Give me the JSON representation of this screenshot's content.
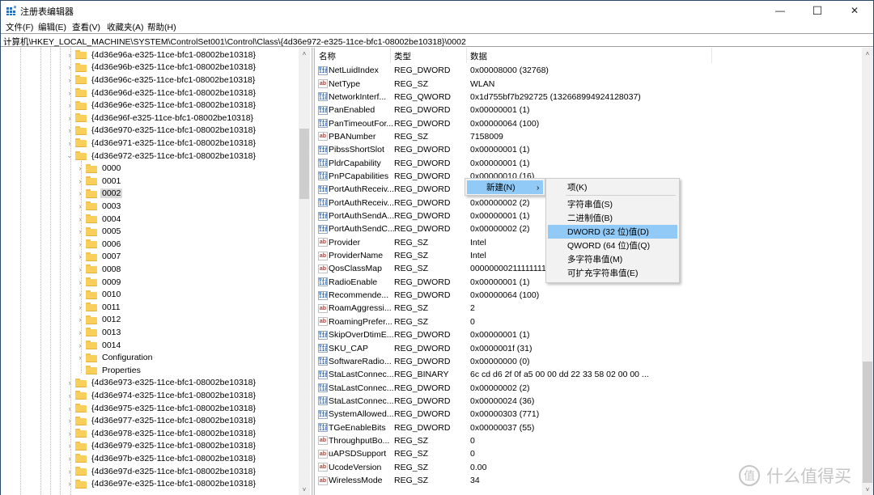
{
  "window": {
    "title": "注册表编辑器",
    "controls": {
      "minimize": "—",
      "maximize": "☐",
      "close": "✕"
    }
  },
  "menu": [
    "文件(F)",
    "编辑(E)",
    "查看(V)",
    "收藏夹(A)",
    "帮助(H)"
  ],
  "address": "计算机\\HKEY_LOCAL_MACHINE\\SYSTEM\\ControlSet001\\Control\\Class\\{4d36e972-e325-11ce-bfc1-08002be10318}\\0002",
  "tree": {
    "items": [
      {
        "label": "{4d36e96a-e325-11ce-bfc1-08002be10318}",
        "level": 0,
        "expander": ">"
      },
      {
        "label": "{4d36e96b-e325-11ce-bfc1-08002be10318}",
        "level": 0,
        "expander": ">"
      },
      {
        "label": "{4d36e96c-e325-11ce-bfc1-08002be10318}",
        "level": 0,
        "expander": ">"
      },
      {
        "label": "{4d36e96d-e325-11ce-bfc1-08002be10318}",
        "level": 0,
        "expander": ">"
      },
      {
        "label": "{4d36e96e-e325-11ce-bfc1-08002be10318}",
        "level": 0,
        "expander": ">"
      },
      {
        "label": "{4d36e96f-e325-11ce-bfc1-08002be10318}",
        "level": 0,
        "expander": ">"
      },
      {
        "label": "{4d36e970-e325-11ce-bfc1-08002be10318}",
        "level": 0,
        "expander": ">"
      },
      {
        "label": "{4d36e971-e325-11ce-bfc1-08002be10318}",
        "level": 0,
        "expander": ">"
      },
      {
        "label": "{4d36e972-e325-11ce-bfc1-08002be10318}",
        "level": 0,
        "expander": "v"
      },
      {
        "label": "0000",
        "level": 1,
        "expander": ">"
      },
      {
        "label": "0001",
        "level": 1,
        "expander": ">"
      },
      {
        "label": "0002",
        "level": 1,
        "expander": ">",
        "selected": true
      },
      {
        "label": "0003",
        "level": 1,
        "expander": ">"
      },
      {
        "label": "0004",
        "level": 1,
        "expander": ">"
      },
      {
        "label": "0005",
        "level": 1,
        "expander": ">"
      },
      {
        "label": "0006",
        "level": 1,
        "expander": ">"
      },
      {
        "label": "0007",
        "level": 1,
        "expander": ">"
      },
      {
        "label": "0008",
        "level": 1,
        "expander": ">"
      },
      {
        "label": "0009",
        "level": 1,
        "expander": ">"
      },
      {
        "label": "0010",
        "level": 1,
        "expander": ">"
      },
      {
        "label": "0011",
        "level": 1,
        "expander": ">"
      },
      {
        "label": "0012",
        "level": 1,
        "expander": ">"
      },
      {
        "label": "0013",
        "level": 1,
        "expander": ">"
      },
      {
        "label": "0014",
        "level": 1,
        "expander": ">"
      },
      {
        "label": "Configuration",
        "level": 1,
        "expander": ">"
      },
      {
        "label": "Properties",
        "level": 1,
        "expander": ""
      },
      {
        "label": "{4d36e973-e325-11ce-bfc1-08002be10318}",
        "level": 0,
        "expander": ">"
      },
      {
        "label": "{4d36e974-e325-11ce-bfc1-08002be10318}",
        "level": 0,
        "expander": ">"
      },
      {
        "label": "{4d36e975-e325-11ce-bfc1-08002be10318}",
        "level": 0,
        "expander": ">"
      },
      {
        "label": "{4d36e977-e325-11ce-bfc1-08002be10318}",
        "level": 0,
        "expander": ">"
      },
      {
        "label": "{4d36e978-e325-11ce-bfc1-08002be10318}",
        "level": 0,
        "expander": ">"
      },
      {
        "label": "{4d36e979-e325-11ce-bfc1-08002be10318}",
        "level": 0,
        "expander": ">"
      },
      {
        "label": "{4d36e97b-e325-11ce-bfc1-08002be10318}",
        "level": 0,
        "expander": ">"
      },
      {
        "label": "{4d36e97d-e325-11ce-bfc1-08002be10318}",
        "level": 0,
        "expander": ">"
      },
      {
        "label": "{4d36e97e-e325-11ce-bfc1-08002be10318}",
        "level": 0,
        "expander": ">"
      }
    ]
  },
  "list": {
    "columns": [
      "名称",
      "类型",
      "数据"
    ],
    "rows": [
      {
        "icon": "bin",
        "name": "NetLuidIndex",
        "type": "REG_DWORD",
        "data": "0x00008000 (32768)"
      },
      {
        "icon": "sz",
        "name": "NetType",
        "type": "REG_SZ",
        "data": "WLAN"
      },
      {
        "icon": "bin",
        "name": "NetworkInterf...",
        "type": "REG_QWORD",
        "data": "0x1d755bf7b292725 (132668994924128037)"
      },
      {
        "icon": "bin",
        "name": "PanEnabled",
        "type": "REG_DWORD",
        "data": "0x00000001 (1)"
      },
      {
        "icon": "bin",
        "name": "PanTimeoutFor...",
        "type": "REG_DWORD",
        "data": "0x00000064 (100)"
      },
      {
        "icon": "sz",
        "name": "PBANumber",
        "type": "REG_SZ",
        "data": "7158009"
      },
      {
        "icon": "bin",
        "name": "PibssShortSlot",
        "type": "REG_DWORD",
        "data": "0x00000001 (1)"
      },
      {
        "icon": "bin",
        "name": "PldrCapability",
        "type": "REG_DWORD",
        "data": "0x00000001 (1)"
      },
      {
        "icon": "bin",
        "name": "PnPCapabilities",
        "type": "REG_DWORD",
        "data": "0x00000010 (16)"
      },
      {
        "icon": "bin",
        "name": "PortAuthReceiv...",
        "type": "REG_DWORD",
        "data": ""
      },
      {
        "icon": "bin",
        "name": "PortAuthReceiv...",
        "type": "REG_DWORD",
        "data": "0x00000002 (2)"
      },
      {
        "icon": "bin",
        "name": "PortAuthSendA...",
        "type": "REG_DWORD",
        "data": "0x00000001 (1)"
      },
      {
        "icon": "bin",
        "name": "PortAuthSendC...",
        "type": "REG_DWORD",
        "data": "0x00000002 (2)"
      },
      {
        "icon": "sz",
        "name": "Provider",
        "type": "REG_SZ",
        "data": "Intel"
      },
      {
        "icon": "sz",
        "name": "ProviderName",
        "type": "REG_SZ",
        "data": "Intel"
      },
      {
        "icon": "sz",
        "name": "QosClassMap",
        "type": "REG_SZ",
        "data": "0000000021111111122"
      },
      {
        "icon": "bin",
        "name": "RadioEnable",
        "type": "REG_DWORD",
        "data": "0x00000001 (1)"
      },
      {
        "icon": "bin",
        "name": "Recommende...",
        "type": "REG_DWORD",
        "data": "0x00000064 (100)"
      },
      {
        "icon": "sz",
        "name": "RoamAggressi...",
        "type": "REG_SZ",
        "data": "2"
      },
      {
        "icon": "sz",
        "name": "RoamingPrefer...",
        "type": "REG_SZ",
        "data": "0"
      },
      {
        "icon": "bin",
        "name": "SkipOverDtimE...",
        "type": "REG_DWORD",
        "data": "0x00000001 (1)"
      },
      {
        "icon": "bin",
        "name": "SKU_CAP",
        "type": "REG_DWORD",
        "data": "0x0000001f (31)"
      },
      {
        "icon": "bin",
        "name": "SoftwareRadio...",
        "type": "REG_DWORD",
        "data": "0x00000000 (0)"
      },
      {
        "icon": "bin",
        "name": "StaLastConnec...",
        "type": "REG_BINARY",
        "data": "6c cd d6 2f 0f a5 00 00 dd 22 33 58 02 00 00 ..."
      },
      {
        "icon": "bin",
        "name": "StaLastConnec...",
        "type": "REG_DWORD",
        "data": "0x00000002 (2)"
      },
      {
        "icon": "bin",
        "name": "StaLastConnec...",
        "type": "REG_DWORD",
        "data": "0x00000024 (36)"
      },
      {
        "icon": "bin",
        "name": "SystemAllowed...",
        "type": "REG_DWORD",
        "data": "0x00000303 (771)"
      },
      {
        "icon": "bin",
        "name": "TGeEnableBits",
        "type": "REG_DWORD",
        "data": "0x00000037 (55)"
      },
      {
        "icon": "sz",
        "name": "ThroughputBo...",
        "type": "REG_SZ",
        "data": "0"
      },
      {
        "icon": "sz",
        "name": "uAPSDSupport",
        "type": "REG_SZ",
        "data": "0"
      },
      {
        "icon": "sz",
        "name": "UcodeVersion",
        "type": "REG_SZ",
        "data": "0.00"
      },
      {
        "icon": "sz",
        "name": "WirelessMode",
        "type": "REG_SZ",
        "data": "34"
      }
    ]
  },
  "context_menu": {
    "new_label": "新建(N)",
    "submenu_arrow": "›",
    "submenu": [
      {
        "label": "项(K)"
      },
      {
        "separator": true
      },
      {
        "label": "字符串值(S)"
      },
      {
        "label": "二进制值(B)"
      },
      {
        "label": "DWORD (32 位)值(D)",
        "highlighted": true
      },
      {
        "label": "QWORD (64 位)值(Q)"
      },
      {
        "label": "多字符串值(M)"
      },
      {
        "label": "可扩充字符串值(E)"
      }
    ]
  },
  "icons": {
    "bin_glyph": "011\n110",
    "sz_glyph": "ab"
  },
  "scroll_glyphs": {
    "up": "˄",
    "down": "˅"
  },
  "watermark": {
    "badge": "值",
    "text": "什么值得买"
  }
}
